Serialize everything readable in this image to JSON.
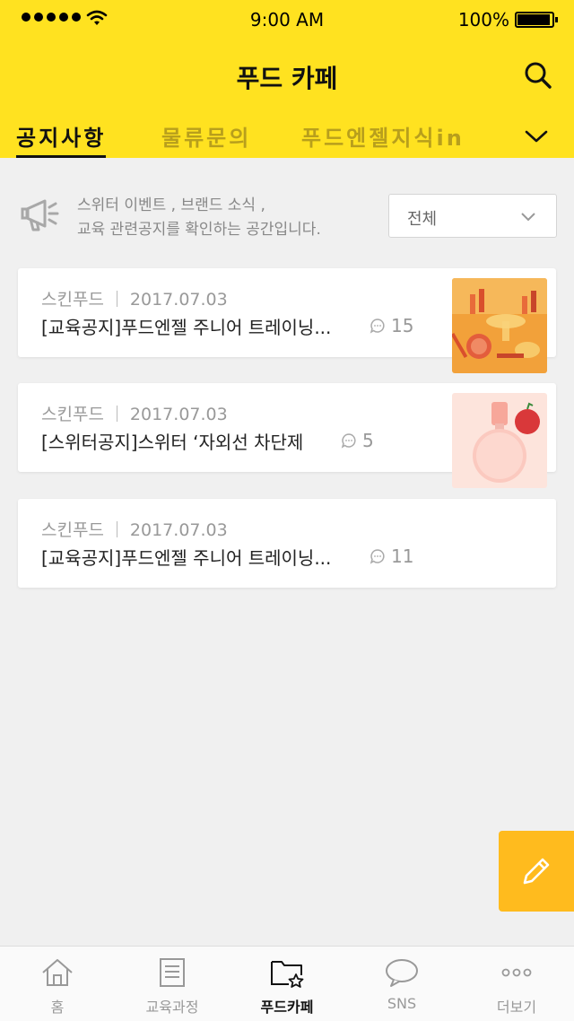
{
  "status_bar": {
    "time": "9:00 AM",
    "battery": "100%"
  },
  "header": {
    "title": "푸드 카페",
    "search_icon": "search-icon"
  },
  "tabs": [
    {
      "label": "공지사항",
      "active": true
    },
    {
      "label": "물류문의",
      "active": false
    },
    {
      "label": "푸드엔젤지식in",
      "active": false
    }
  ],
  "notice": {
    "line1": "스위터 이벤트 , 브랜드 소식 ,",
    "line2": "교육 관련공지를 확인하는 공간입니다."
  },
  "filter": {
    "selected": "전체"
  },
  "posts": [
    {
      "author": "스킨푸드",
      "date": "2017.07.03",
      "title": "[교육공지]푸드엔젤 주니어 트레이닝...",
      "comments": "15",
      "has_thumb": true
    },
    {
      "author": "스킨푸드",
      "date": "2017.07.03",
      "title": "[스위터공지]스위터 ‘자외선 차단제",
      "comments": "5",
      "has_thumb": true
    },
    {
      "author": "스킨푸드",
      "date": "2017.07.03",
      "title": "[교육공지]푸드엔젤 주니어 트레이닝...",
      "comments": "11",
      "has_thumb": false
    }
  ],
  "tabbar": [
    {
      "label": "홈",
      "icon": "home-icon"
    },
    {
      "label": "교육과정",
      "icon": "document-icon"
    },
    {
      "label": "푸드카페",
      "icon": "folder-star-icon",
      "active": true
    },
    {
      "label": "SNS",
      "icon": "chat-bubble-icon"
    },
    {
      "label": "더보기",
      "icon": "more-dots-icon"
    }
  ],
  "colors": {
    "brand_yellow": "#ffe220",
    "fab_orange": "#ffbb1e"
  }
}
